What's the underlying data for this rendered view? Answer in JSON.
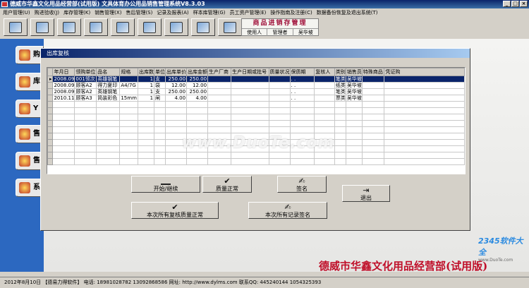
{
  "window": {
    "title": "德威市华鑫文化用品经营部(试用版)  文具体育办公用品销售管理系统V8.3.03"
  },
  "menu": [
    "用户管理(U)",
    "购进验收(J)",
    "库存管理(K)",
    "销售管理(X)",
    "售后管理(S)",
    "记录及报表(A)",
    "样本库管理(G)",
    "员工资产管理(E)",
    "操作指南及注册(C)",
    "数据备份恢复及退出系统(T)"
  ],
  "toolbar_icons": [
    "refresh-icon",
    "purchase-icon",
    "search-icon",
    "document-icon",
    "list-icon",
    "chart-icon",
    "calendar-icon",
    "export-icon",
    "exit-icon"
  ],
  "brand": {
    "title": "商品进销存管理",
    "user_label": "使用人",
    "role": "管理者",
    "user": "吴华坡"
  },
  "left_nav": [
    {
      "label": "购",
      "icon": "purchase-icon"
    },
    {
      "label": "库",
      "icon": "warehouse-icon"
    },
    {
      "label": "Y",
      "icon": "sales-return-icon"
    },
    {
      "label": "售",
      "icon": "sales-icon"
    },
    {
      "label": "售",
      "icon": "after-sales-icon"
    },
    {
      "label": "系",
      "icon": "system-icon"
    }
  ],
  "dialog": {
    "title": "出库复核",
    "columns": [
      "年月日",
      "领购单位",
      "品名",
      "规格",
      "出库数",
      "单位",
      "出库单价",
      "出库金额",
      "生产厂商",
      "生产日期或批号",
      "质量状况",
      "保质期",
      "复核人",
      "类别",
      "销售员",
      "特殊商品",
      "凭证购"
    ],
    "rows": [
      [
        "2008.09",
        "001领次",
        "英雄钢笔",
        "",
        "1",
        "支",
        "250.00",
        "250.00",
        "",
        "",
        "",
        ". .",
        "",
        "笔类",
        "吴华坡",
        "",
        ""
      ],
      [
        "2008.09",
        "顾客A2",
        "得力夏印",
        "A4/7G",
        "1",
        "袋",
        "12.00",
        "12.00",
        "",
        "",
        "",
        ". .",
        "",
        "纸类",
        "吴华坡",
        "",
        ""
      ],
      [
        "2008.09",
        "顾客A2",
        "英雄钢笔",
        "",
        "1",
        "支",
        "250.00",
        "250.00",
        "",
        "",
        "",
        ". .",
        "",
        "笔类",
        "吴华坡",
        "",
        ""
      ],
      [
        "2010.11",
        "顾客A3",
        "简装彩色",
        "15mm",
        "1",
        "闸",
        "4.00",
        "4.00",
        "",
        "",
        "",
        ". .",
        "",
        "票类",
        "吴华坡",
        "",
        ""
      ]
    ],
    "buttons": {
      "start": "开始/继续",
      "quality_ok": "质量正常",
      "sign": "签名",
      "exit": "退出",
      "all_quality_ok": "本次所有复核质量正常",
      "all_sign": "本次所有记录签名"
    }
  },
  "watermark": "www.DuoTe.com",
  "watermark2": {
    "brand": "2345软件大全",
    "url": "www.DuoTe.com"
  },
  "company": "德威市华鑫文化用品经营部(试用版)",
  "statusbar": "2012年8月10日 【德易力得软件】  电话:  18981028782  13092868586  网址:  http://www.dylms.com  联系QQ:  445240144   1054325393"
}
